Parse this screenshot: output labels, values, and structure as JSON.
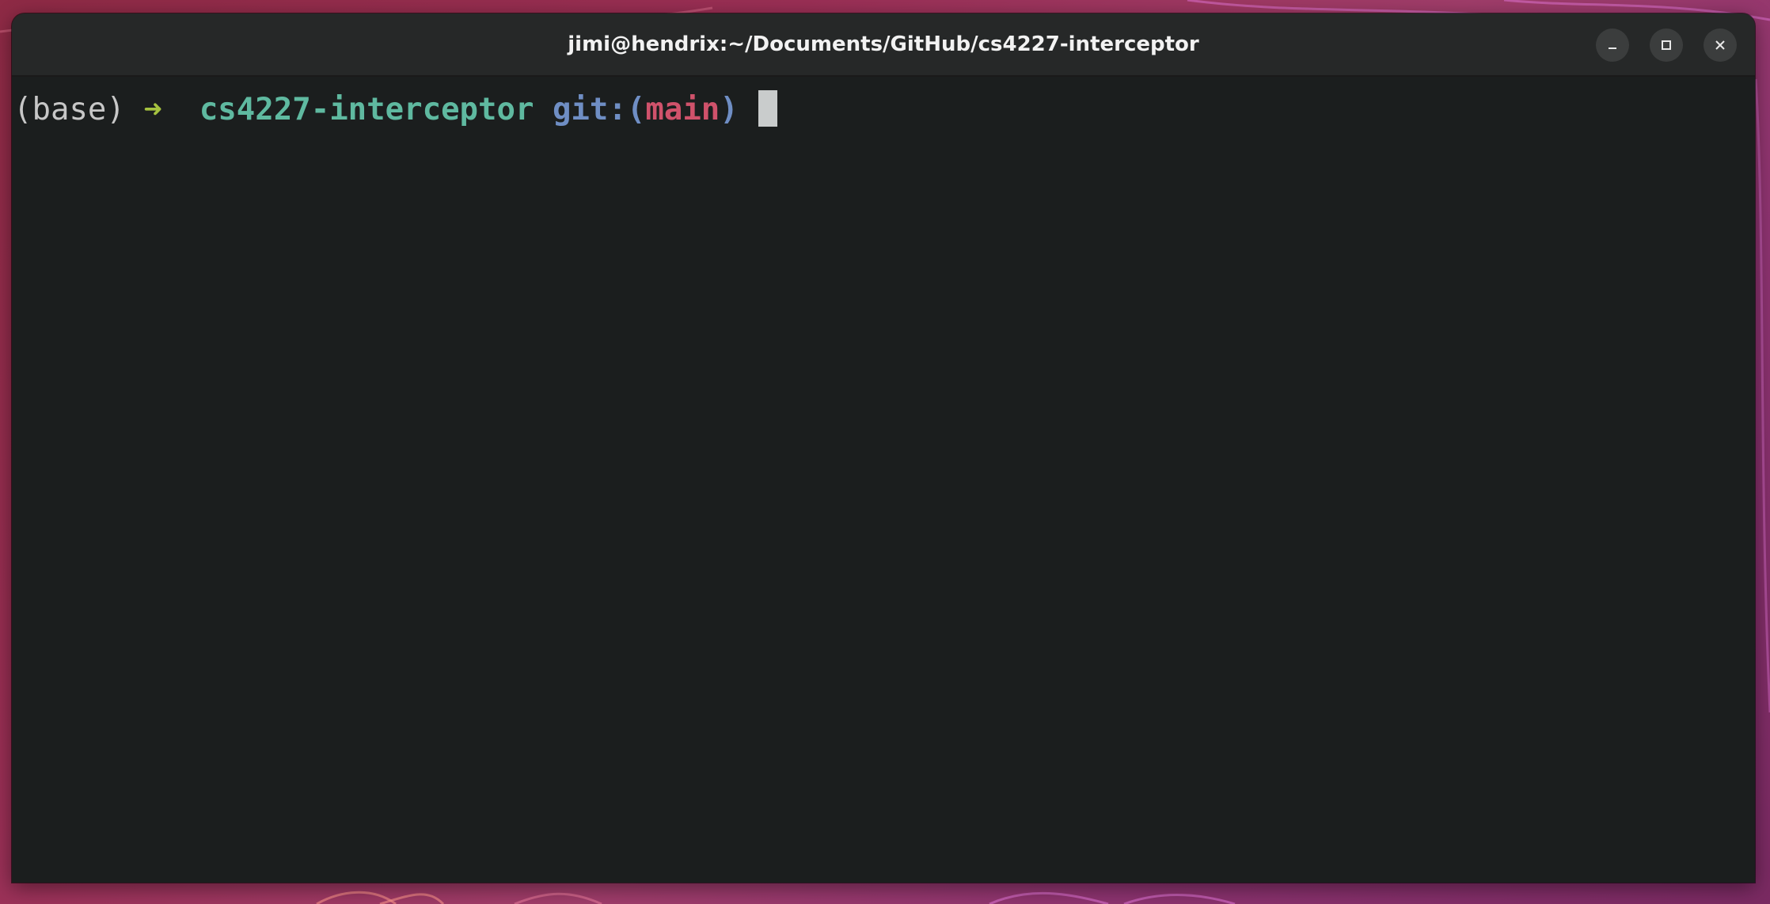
{
  "window": {
    "title": "jimi@hendrix:~/Documents/GitHub/cs4227-interceptor",
    "controls": {
      "minimize": "minimize-icon",
      "maximize": "maximize-icon",
      "close": "close-icon"
    }
  },
  "terminal": {
    "prompt": {
      "env": "(base)",
      "arrow": "➜",
      "directory": "cs4227-interceptor",
      "git_label": "git:(",
      "branch": "main",
      "git_close": ")"
    }
  },
  "colors": {
    "terminal_bg": "#1b1e1e",
    "titlebar_bg": "#262828",
    "env_text": "#c7c7c7",
    "arrow": "#a5c23f",
    "directory": "#5fb9a0",
    "git_label": "#6f8ec4",
    "branch": "#d0526b",
    "cursor": "#c9cccc"
  }
}
